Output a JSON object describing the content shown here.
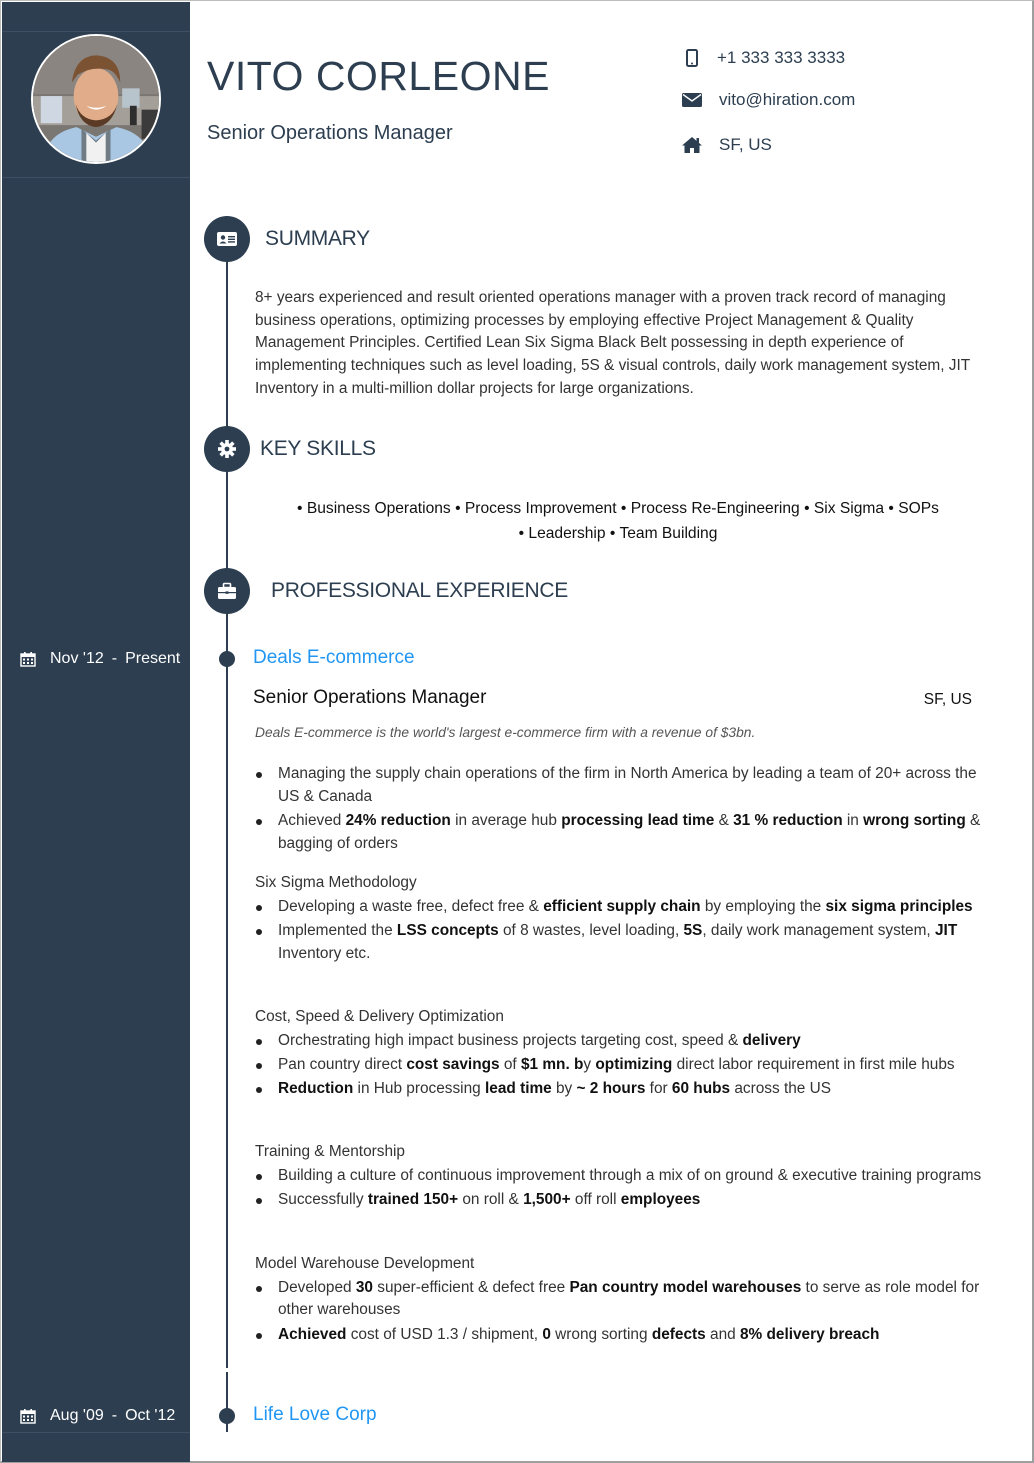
{
  "profile": {
    "name": "VITO CORLEONE",
    "headline": "Senior Operations Manager",
    "photo_icon": "profile-photo"
  },
  "contact": {
    "phone": {
      "icon": "mobile-phone-icon",
      "value": "+1 333 333 3333"
    },
    "email": {
      "icon": "envelope-icon",
      "value": "vito@hiration.com"
    },
    "location": {
      "icon": "home-icon",
      "value": "SF, US"
    }
  },
  "sections": {
    "summary": {
      "icon": "id-card-icon",
      "title": "SUMMARY",
      "text": "8+ years experienced and result oriented operations manager with a proven track record of managing business operations, optimizing processes by employing effective Project Management & Quality Management Principles. Certified Lean Six Sigma Black Belt possessing in depth experience of implementing techniques such as level loading, 5S & visual controls, daily work management system, JIT Inventory in a multi-million dollar projects for large organizations."
    },
    "skills": {
      "icon": "gear-icon",
      "title": "KEY SKILLS",
      "items": [
        "Business Operations",
        "Process Improvement",
        "Process Re-Engineering",
        "Six Sigma",
        "SOPs",
        "Leadership",
        "Team Building"
      ]
    },
    "experience": {
      "icon": "briefcase-icon",
      "title": "PROFESSIONAL EXPERIENCE",
      "jobs": [
        {
          "dates": {
            "icon": "calendar-icon",
            "start": "Nov '12",
            "sep": "-",
            "end": "Present"
          },
          "company": "Deals E-commerce",
          "title": "Senior Operations Manager",
          "location": "SF, US",
          "description": "Deals E-commerce is the world's largest e-commerce firm with a revenue of $3bn.",
          "groups": [
            {
              "title": "",
              "bullets": [
                [
                  {
                    "t": "Managing the supply chain operations of the firm in North America by leading a team of 20+ across the US & Canada"
                  }
                ],
                [
                  {
                    "t": "Achieved "
                  },
                  {
                    "b": "24% reduction"
                  },
                  {
                    "t": " in average hub "
                  },
                  {
                    "b": "processing lead time"
                  },
                  {
                    "t": " & "
                  },
                  {
                    "b": "31 % reduction"
                  },
                  {
                    "t": " in "
                  },
                  {
                    "b": "wrong sorting"
                  },
                  {
                    "t": " & bagging of orders"
                  }
                ]
              ]
            },
            {
              "title": "Six Sigma Methodology",
              "bullets": [
                [
                  {
                    "t": "Developing a waste free, defect free & "
                  },
                  {
                    "b": "efficient supply chain"
                  },
                  {
                    "t": " by employing the "
                  },
                  {
                    "b": "six sigma principles"
                  }
                ],
                [
                  {
                    "t": "Implemented the "
                  },
                  {
                    "b": "LSS concepts"
                  },
                  {
                    "t": " of 8 wastes, level loading, "
                  },
                  {
                    "b": "5S"
                  },
                  {
                    "t": ", daily work management system, "
                  },
                  {
                    "b": "JIT"
                  },
                  {
                    "t": " Inventory etc."
                  }
                ]
              ]
            },
            {
              "title": "Cost, Speed & Delivery Optimization",
              "bullets": [
                [
                  {
                    "t": "Orchestrating high impact business projects targeting cost, speed & "
                  },
                  {
                    "b": "delivery"
                  }
                ],
                [
                  {
                    "t": "Pan country direct "
                  },
                  {
                    "b": "cost savings"
                  },
                  {
                    "t": " of "
                  },
                  {
                    "b": "$1 mn. b"
                  },
                  {
                    "t": "y "
                  },
                  {
                    "b": "optimizing"
                  },
                  {
                    "t": " direct labor requirement in first mile hubs"
                  }
                ],
                [
                  {
                    "b": "Reduction"
                  },
                  {
                    "t": " in Hub processing "
                  },
                  {
                    "b": "lead time"
                  },
                  {
                    "t": " by "
                  },
                  {
                    "b": "~ 2 hours"
                  },
                  {
                    "t": " for "
                  },
                  {
                    "b": "60 hubs"
                  },
                  {
                    "t": " across the US"
                  }
                ]
              ]
            },
            {
              "title": "Training & Mentorship",
              "bullets": [
                [
                  {
                    "t": "Building a culture of continuous improvement through a mix of on ground & executive training programs"
                  }
                ],
                [
                  {
                    "t": "Successfully "
                  },
                  {
                    "b": "trained 150+"
                  },
                  {
                    "t": " on roll & "
                  },
                  {
                    "b": "1,500+"
                  },
                  {
                    "t": " off roll "
                  },
                  {
                    "b": "employees"
                  }
                ]
              ]
            },
            {
              "title": "Model Warehouse Development",
              "bullets": [
                [
                  {
                    "t": "Developed "
                  },
                  {
                    "b": "30"
                  },
                  {
                    "t": " super-efficient & defect free "
                  },
                  {
                    "b": "Pan country model warehouses"
                  },
                  {
                    "t": " to serve as role model for other warehouses"
                  }
                ],
                [
                  {
                    "b": "Achieved"
                  },
                  {
                    "t": " cost of USD 1.3 / shipment, "
                  },
                  {
                    "b": "0"
                  },
                  {
                    "t": " wrong sorting "
                  },
                  {
                    "b": "defects"
                  },
                  {
                    "t": " and "
                  },
                  {
                    "b": "8% delivery breach"
                  }
                ]
              ]
            }
          ]
        },
        {
          "dates": {
            "icon": "calendar-icon",
            "start": "Aug '09",
            "sep": "-",
            "end": "Oct '12"
          },
          "company": "Life Love Corp"
        }
      ]
    }
  },
  "colors": {
    "sidebar": "#2c3e50",
    "accent": "#2196f3",
    "heading": "#2c3e50"
  }
}
